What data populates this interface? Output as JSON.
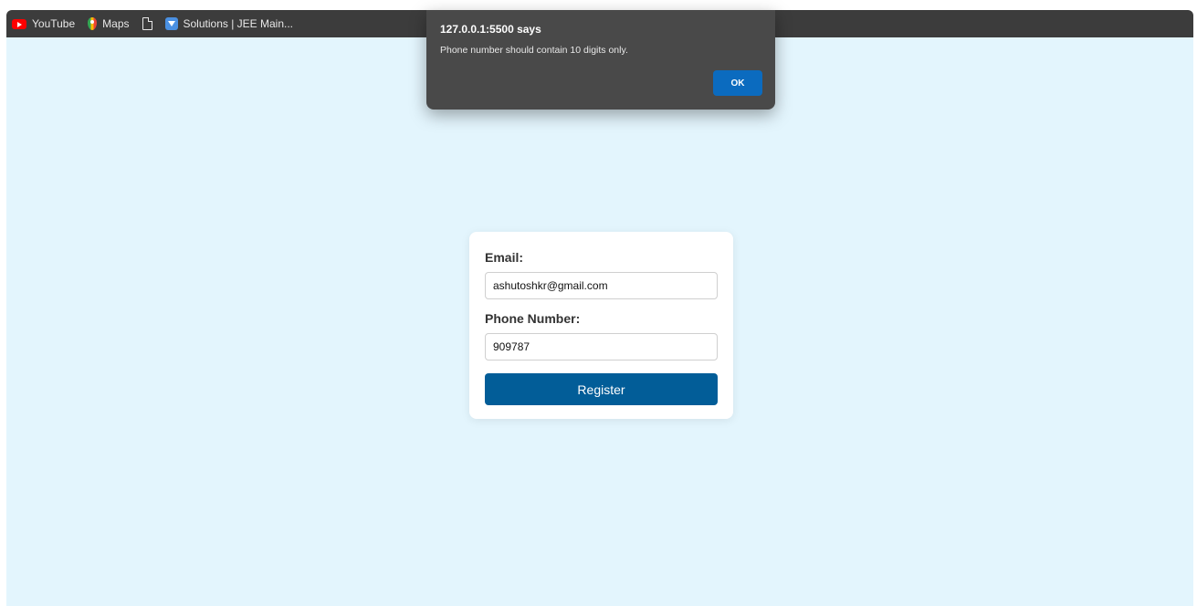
{
  "bookmarks": [
    {
      "label": "YouTube",
      "icon": "youtube-icon"
    },
    {
      "label": "Maps",
      "icon": "maps-icon"
    },
    {
      "label": "",
      "icon": "document-icon"
    },
    {
      "label": "Solutions | JEE Main...",
      "icon": "solutions-icon"
    }
  ],
  "form": {
    "email_label": "Email:",
    "email_value": "ashutoshkr@gmail.com",
    "phone_label": "Phone Number:",
    "phone_value": "909787",
    "register_label": "Register"
  },
  "alert": {
    "title": "127.0.0.1:5500 says",
    "message": "Phone number should contain 10 digits only.",
    "ok_label": "OK"
  },
  "colors": {
    "page_background": "#e3f5fd",
    "register_button": "#025d98",
    "alert_background": "#494949",
    "alert_ok_button": "#0b6bbf",
    "bookmarks_bar": "#3c3c3c"
  }
}
